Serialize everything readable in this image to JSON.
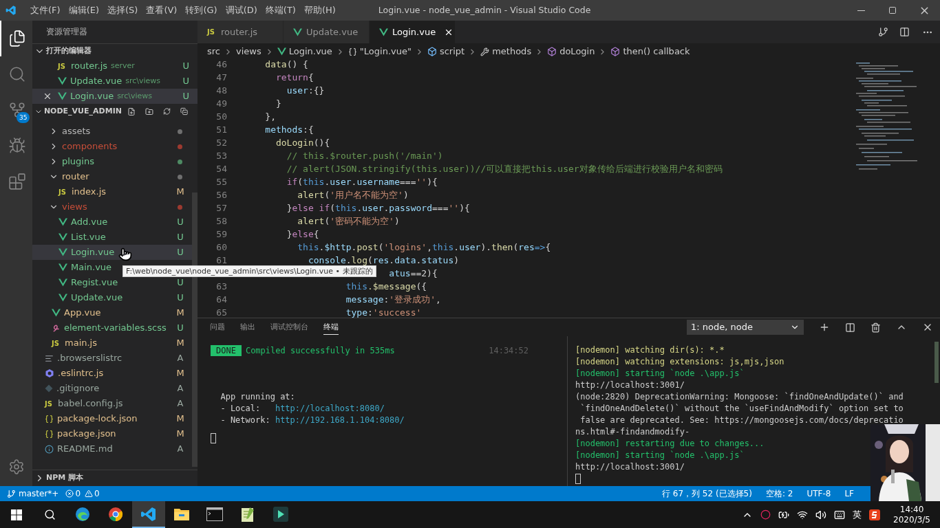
{
  "title_bar": {
    "menus": [
      "文件(F)",
      "编辑(E)",
      "选择(S)",
      "查看(V)",
      "转到(G)",
      "调试(D)",
      "终端(T)",
      "帮助(H)"
    ],
    "title": "Login.vue - node_vue_admin - Visual Studio Code"
  },
  "activity_bar": [
    {
      "kind": "files",
      "selected": true
    },
    {
      "kind": "search",
      "selected": false
    },
    {
      "kind": "scm",
      "selected": false,
      "badge": "35"
    },
    {
      "kind": "debug",
      "selected": false
    },
    {
      "kind": "extensions",
      "selected": false
    }
  ],
  "sidebar": {
    "title": "资源管理器",
    "open_editors": {
      "title": "打开的编辑器",
      "expanded": true,
      "items": [
        {
          "kind": "js",
          "icon": "JS",
          "name": "router.js",
          "path": "server",
          "status": "U",
          "selected": false
        },
        {
          "kind": "vue",
          "name": "Update.vue",
          "path": "src\\views",
          "status": "U",
          "selected": false
        },
        {
          "kind": "vue",
          "name": "Login.vue",
          "path": "src\\views",
          "status": "U",
          "selected": true
        }
      ]
    },
    "project": {
      "title": "NODE_VUE_ADMIN",
      "expanded": true,
      "nested_items": [
        {
          "kind": "folder",
          "label": "assets",
          "expanded": false,
          "selected": false,
          "color": "#b8b8b8",
          "decoration": {
            "kind": "dot",
            "color": "#6f6f6f"
          }
        },
        {
          "kind": "folder",
          "label": "components",
          "expanded": false,
          "selected": false,
          "color": "#c74e39",
          "decoration": {
            "kind": "dot",
            "color": "#9c3a30"
          }
        },
        {
          "kind": "folder",
          "label": "plugins",
          "expanded": false,
          "selected": false,
          "color": "#73c991",
          "decoration": {
            "kind": "dot",
            "color": "#4e8a63"
          }
        },
        {
          "kind": "folder",
          "label": "router",
          "expanded": true,
          "selected": false,
          "color": "#e2c08d",
          "decoration": {
            "kind": "dot",
            "color": "#6f6f6f"
          },
          "children": [
            {
              "kind": "js",
              "icon": "JS",
              "label": "index.js",
              "selected": false,
              "color": "#e2c08d",
              "decoration": {
                "kind": "letter",
                "text": "M",
                "color": "#e2c08d"
              }
            }
          ]
        },
        {
          "kind": "folder",
          "label": "views",
          "expanded": true,
          "selected": false,
          "color": "#c74e39",
          "decoration": {
            "kind": "dot",
            "color": "#9c3a30"
          },
          "children": [
            {
              "kind": "vue",
              "label": "Add.vue",
              "selected": false,
              "color": "#73c991",
              "decoration": {
                "kind": "letter",
                "text": "U",
                "color": "#73c991"
              }
            },
            {
              "kind": "vue",
              "label": "List.vue",
              "selected": false,
              "color": "#73c991",
              "decoration": {
                "kind": "letter",
                "text": "U",
                "color": "#73c991"
              }
            },
            {
              "kind": "vue",
              "label": "Login.vue",
              "selected": true,
              "color": "#73c991",
              "decoration": {
                "kind": "letter",
                "text": "U",
                "color": "#73c991"
              }
            },
            {
              "kind": "vue",
              "label": "Main.vue",
              "selected": false,
              "color": "#73c991"
            },
            {
              "kind": "vue",
              "label": "Regist.vue",
              "selected": false,
              "color": "#73c991",
              "decoration": {
                "kind": "letter",
                "text": "U",
                "color": "#73c991"
              }
            },
            {
              "kind": "vue",
              "label": "Update.vue",
              "selected": false,
              "color": "#73c991",
              "decoration": {
                "kind": "letter",
                "text": "U",
                "color": "#73c991"
              }
            }
          ]
        },
        {
          "kind": "vue",
          "label": "App.vue",
          "selected": false,
          "color": "#e2c08d",
          "decoration": {
            "kind": "letter",
            "text": "M",
            "color": "#e2c08d"
          }
        },
        {
          "kind": "scss",
          "label": "element-variables.scss",
          "selected": false,
          "color": "#73c991",
          "decoration": {
            "kind": "letter",
            "text": "U",
            "color": "#73c991"
          }
        },
        {
          "kind": "js",
          "icon": "JS",
          "label": "main.js",
          "selected": false,
          "color": "#e2c08d",
          "decoration": {
            "kind": "letter",
            "text": "M",
            "color": "#e2c08d"
          }
        }
      ],
      "items": [
        {
          "kind": "config",
          "label": ".browserslistrc",
          "selected": false,
          "color": "#9aa8a0",
          "decoration": {
            "kind": "letter",
            "text": "A",
            "color": "#9aa8a0"
          }
        },
        {
          "kind": "eslint",
          "label": ".eslintrc.js",
          "selected": false,
          "color": "#e2c08d",
          "decoration": {
            "kind": "letter",
            "text": "M",
            "color": "#e2c08d"
          }
        },
        {
          "kind": "git",
          "label": ".gitignore",
          "selected": false,
          "color": "#9aa8a0",
          "decoration": {
            "kind": "letter",
            "text": "A",
            "color": "#9aa8a0"
          }
        },
        {
          "kind": "js",
          "icon": "JS",
          "label": "babel.config.js",
          "selected": false,
          "color": "#9aa8a0",
          "decoration": {
            "kind": "letter",
            "text": "A",
            "color": "#9aa8a0"
          }
        },
        {
          "kind": "json",
          "label": "package-lock.json",
          "selected": false,
          "color": "#e2c08d",
          "decoration": {
            "kind": "letter",
            "text": "M",
            "color": "#e2c08d"
          }
        },
        {
          "kind": "json",
          "label": "package.json",
          "selected": false,
          "color": "#e2c08d",
          "decoration": {
            "kind": "letter",
            "text": "M",
            "color": "#e2c08d"
          }
        },
        {
          "kind": "info",
          "label": "README.md",
          "selected": false,
          "color": "#9aa8a0",
          "decoration": {
            "kind": "letter",
            "text": "A",
            "color": "#9aa8a0"
          }
        }
      ]
    },
    "npm": {
      "title": "NPM 脚本",
      "expanded": false
    }
  },
  "tooltip": "F:\\web\\node_vue\\node_vue_admin\\src\\views\\Login.vue • 未跟踪的",
  "tabs": [
    {
      "kind": "js",
      "icon": "JS",
      "label": "router.js",
      "selected": false
    },
    {
      "kind": "vue",
      "label": "Update.vue",
      "selected": false
    },
    {
      "kind": "vue",
      "label": "Login.vue",
      "selected": true
    }
  ],
  "breadcrumbs": [
    {
      "kind": "text",
      "label": "src"
    },
    {
      "kind": "text",
      "label": "views"
    },
    {
      "kind": "vue",
      "label": "Login.vue"
    },
    {
      "kind": "braces",
      "label": "\"Login.vue\""
    },
    {
      "kind": "module",
      "label": "script"
    },
    {
      "kind": "wrench",
      "label": "methods"
    },
    {
      "kind": "cube",
      "label": "doLogin"
    },
    {
      "kind": "cube",
      "label": "then() callback"
    }
  ],
  "code": [
    {
      "n": "46",
      "tokens": [
        {
          "kind": "fn",
          "text": "    data"
        },
        {
          "kind": "p",
          "text": "() {"
        }
      ]
    },
    {
      "n": "47",
      "tokens": [
        {
          "kind": "kw",
          "text": "      return"
        },
        {
          "kind": "p",
          "text": "{"
        }
      ]
    },
    {
      "n": "48",
      "tokens": [
        {
          "kind": "var",
          "text": "        user"
        },
        {
          "kind": "p",
          "text": ":{}"
        }
      ]
    },
    {
      "n": "49",
      "tokens": [
        {
          "kind": "p",
          "text": "      }"
        }
      ]
    },
    {
      "n": "50",
      "tokens": [
        {
          "kind": "p",
          "text": "    },"
        }
      ]
    },
    {
      "n": "51",
      "tokens": [
        {
          "kind": "var",
          "text": "    methods"
        },
        {
          "kind": "p",
          "text": ":{"
        }
      ]
    },
    {
      "n": "52",
      "tokens": [
        {
          "kind": "fn",
          "text": "      doLogin"
        },
        {
          "kind": "p",
          "text": "(){"
        }
      ]
    },
    {
      "n": "53",
      "tokens": [
        {
          "kind": "com",
          "text": "        // this.$router.push('/main')"
        }
      ]
    },
    {
      "n": "54",
      "tokens": [
        {
          "kind": "com",
          "text": "        // alert(JSON.stringify(this.user))//可以直接把this.user对象传给后端进行校验用户名和密码"
        }
      ]
    },
    {
      "n": "55",
      "tokens": [
        {
          "kind": "kw",
          "text": "        if"
        },
        {
          "kind": "p",
          "text": "("
        },
        {
          "kind": "this",
          "text": "this"
        },
        {
          "kind": "p",
          "text": "."
        },
        {
          "kind": "var",
          "text": "user"
        },
        {
          "kind": "p",
          "text": "."
        },
        {
          "kind": "var",
          "text": "username"
        },
        {
          "kind": "p",
          "text": "==="
        },
        {
          "kind": "str",
          "text": "''"
        },
        {
          "kind": "p",
          "text": "){"
        }
      ]
    },
    {
      "n": "56",
      "tokens": [
        {
          "kind": "fn",
          "text": "          alert"
        },
        {
          "kind": "p",
          "text": "("
        },
        {
          "kind": "str",
          "text": "'用户名不能为空'"
        },
        {
          "kind": "p",
          "text": ")"
        }
      ]
    },
    {
      "n": "57",
      "tokens": [
        {
          "kind": "p",
          "text": "        }"
        },
        {
          "kind": "kw",
          "text": "else if"
        },
        {
          "kind": "p",
          "text": "("
        },
        {
          "kind": "this",
          "text": "this"
        },
        {
          "kind": "p",
          "text": "."
        },
        {
          "kind": "var",
          "text": "user"
        },
        {
          "kind": "p",
          "text": "."
        },
        {
          "kind": "var",
          "text": "password"
        },
        {
          "kind": "p",
          "text": "==="
        },
        {
          "kind": "str",
          "text": "''"
        },
        {
          "kind": "p",
          "text": "){"
        }
      ]
    },
    {
      "n": "58",
      "tokens": [
        {
          "kind": "fn",
          "text": "          alert"
        },
        {
          "kind": "p",
          "text": "("
        },
        {
          "kind": "str",
          "text": "'密码不能为空'"
        },
        {
          "kind": "p",
          "text": ")"
        }
      ]
    },
    {
      "n": "59",
      "tokens": [
        {
          "kind": "p",
          "text": "        }"
        },
        {
          "kind": "kw",
          "text": "else"
        },
        {
          "kind": "p",
          "text": "{"
        }
      ]
    },
    {
      "n": "60",
      "tokens": [
        {
          "kind": "this",
          "text": "          this"
        },
        {
          "kind": "p",
          "text": "."
        },
        {
          "kind": "var",
          "text": "$http"
        },
        {
          "kind": "p",
          "text": "."
        },
        {
          "kind": "fn",
          "text": "post"
        },
        {
          "kind": "p",
          "text": "("
        },
        {
          "kind": "str",
          "text": "'logins'"
        },
        {
          "kind": "p",
          "text": ","
        },
        {
          "kind": "this",
          "text": "this"
        },
        {
          "kind": "p",
          "text": "."
        },
        {
          "kind": "var",
          "text": "user"
        },
        {
          "kind": "p",
          "text": ")."
        },
        {
          "kind": "fn",
          "text": "then"
        },
        {
          "kind": "p",
          "text": "("
        },
        {
          "kind": "var",
          "text": "res"
        },
        {
          "kind": "this",
          "text": "=>"
        },
        {
          "kind": "p",
          "text": "{"
        }
      ]
    },
    {
      "n": "61",
      "tokens": [
        {
          "kind": "var",
          "text": "            console"
        },
        {
          "kind": "p",
          "text": "."
        },
        {
          "kind": "fn",
          "text": "log"
        },
        {
          "kind": "p",
          "text": "("
        },
        {
          "kind": "var",
          "text": "res"
        },
        {
          "kind": "p",
          "text": "."
        },
        {
          "kind": "var",
          "text": "data"
        },
        {
          "kind": "p",
          "text": "."
        },
        {
          "kind": "var",
          "text": "status"
        },
        {
          "kind": "p",
          "text": ")"
        }
      ]
    },
    {
      "tokens": [
        {
          "kind": "var",
          "text": "                           atus"
        },
        {
          "kind": "p",
          "text": "==2){"
        }
      ]
    },
    {
      "n": "63",
      "tokens": [
        {
          "kind": "this",
          "text": "                   this"
        },
        {
          "kind": "fn",
          "text": ".$message"
        },
        {
          "kind": "p",
          "text": "({"
        }
      ]
    },
    {
      "n": "64",
      "tokens": [
        {
          "kind": "var",
          "text": "                   message"
        },
        {
          "kind": "p",
          "text": ":"
        },
        {
          "kind": "str",
          "text": "'登录成功'"
        },
        {
          "kind": "p",
          "text": ","
        }
      ]
    },
    {
      "n": "65",
      "tokens": [
        {
          "kind": "var",
          "text": "                   type"
        },
        {
          "kind": "p",
          "text": ":"
        },
        {
          "kind": "str",
          "text": "'success'"
        }
      ]
    }
  ],
  "panel": {
    "tabs": [
      {
        "label": "问题",
        "selected": false
      },
      {
        "label": "输出",
        "selected": false
      },
      {
        "label": "调试控制台",
        "selected": false
      },
      {
        "label": "终端",
        "selected": true
      }
    ],
    "terminal_select": "1: node, node",
    "left_terminal": {
      "badge": "DONE",
      "message": "Compiled successfully in 535ms",
      "time": "14:34:52",
      "lines": [
        [
          {
            "kind": "p",
            "text": "  App running at:"
          }
        ],
        [
          {
            "kind": "p",
            "text": "  - Local:   "
          },
          {
            "kind": "link",
            "text": "http://localhost:8080/"
          }
        ],
        [
          {
            "kind": "p",
            "text": "  - Network: "
          },
          {
            "kind": "link",
            "text": "http://192.168.1.104:8080/"
          }
        ]
      ]
    },
    "right_terminal": [
      {
        "kind": "yellow",
        "text": "[nodemon] watching dir(s): *.*"
      },
      {
        "kind": "yellow",
        "text": "[nodemon] watching extensions: js,mjs,json"
      },
      {
        "kind": "green",
        "text": "[nodemon] starting `node .\\app.js`"
      },
      {
        "kind": "plain",
        "text": "http://localhost:3001/"
      },
      {
        "kind": "plain",
        "text": "(node:2820) DeprecationWarning: Mongoose: `findOneAndUpdate()` and"
      },
      {
        "kind": "plain",
        "text": " `findOneAndDelete()` without the `useFindAndModify` option set to"
      },
      {
        "kind": "plain",
        "text": " false are deprecated. See: https://mongoosejs.com/docs/deprecatio"
      },
      {
        "kind": "plain",
        "text": "ns.html#-findandmodify-"
      },
      {
        "kind": "green",
        "text": "[nodemon] restarting due to changes..."
      },
      {
        "kind": "green",
        "text": "[nodemon] starting `node .\\app.js`"
      },
      {
        "kind": "plain",
        "text": "http://localhost:3001/"
      }
    ]
  },
  "status_bar": {
    "branch": "master*+",
    "errors": "0",
    "warnings": "0",
    "right": [
      "行 67，列 52 (已选择5)",
      "空格: 2",
      "UTF-8",
      "LF"
    ]
  },
  "taskbar": {
    "apps": [
      {
        "kind": "edge",
        "selected": false
      },
      {
        "kind": "chrome",
        "selected": false
      },
      {
        "kind": "vscode",
        "selected": true
      },
      {
        "kind": "explorer",
        "selected": false
      },
      {
        "kind": "terminal",
        "selected": false
      },
      {
        "kind": "notepad",
        "selected": false
      },
      {
        "kind": "filmora",
        "selected": false
      }
    ],
    "ime": "英",
    "time": "14:40",
    "date": "2020/3/5"
  }
}
